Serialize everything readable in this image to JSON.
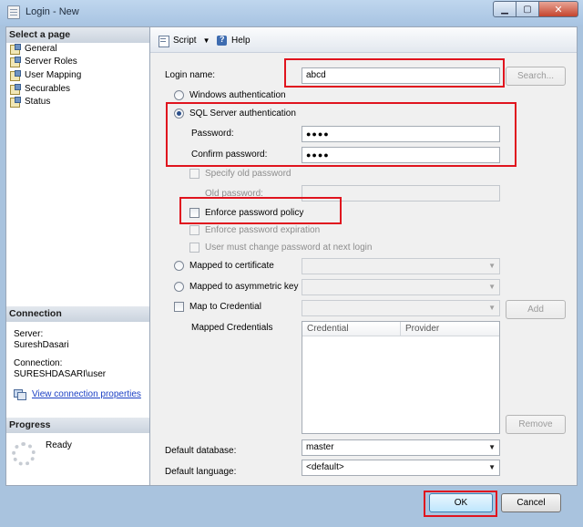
{
  "window": {
    "title": "Login - New"
  },
  "left": {
    "select_page_header": "Select a page",
    "pages": [
      {
        "label": "General"
      },
      {
        "label": "Server Roles"
      },
      {
        "label": "User Mapping"
      },
      {
        "label": "Securables"
      },
      {
        "label": "Status"
      }
    ],
    "connection_header": "Connection",
    "server_label": "Server:",
    "server_value": "SureshDasari",
    "connection_label": "Connection:",
    "connection_value": "SURESHDASARI\\user",
    "view_props_link": "View connection properties",
    "progress_header": "Progress",
    "progress_status": "Ready"
  },
  "toolbar": {
    "script_label": "Script",
    "help_label": "Help"
  },
  "form": {
    "login_name_label": "Login name:",
    "login_name_value": "abcd",
    "search_button": "Search...",
    "windows_auth": "Windows authentication",
    "sql_auth": "SQL Server authentication",
    "password_label": "Password:",
    "password_value": "●●●●",
    "confirm_label": "Confirm password:",
    "confirm_value": "●●●●",
    "specify_old": "Specify old password",
    "old_password_label": "Old password:",
    "enforce_policy": "Enforce password policy",
    "enforce_expiration": "Enforce password expiration",
    "must_change": "User must change password at next login",
    "mapped_cert": "Mapped to certificate",
    "mapped_asym": "Mapped to asymmetric key",
    "map_credential": "Map to Credential",
    "add_button": "Add",
    "mapped_credentials_label": "Mapped Credentials",
    "col_credential": "Credential",
    "col_provider": "Provider",
    "remove_button": "Remove",
    "default_db_label": "Default database:",
    "default_db_value": "master",
    "default_lang_label": "Default language:",
    "default_lang_value": "<default>"
  },
  "footer": {
    "ok": "OK",
    "cancel": "Cancel"
  },
  "colors": {
    "highlight": "#e0141e",
    "link": "#1a3fc4",
    "chrome": "#a9c3de"
  },
  "icons": {
    "page": "page-icon",
    "script": "script-icon",
    "help": "help-icon",
    "minimize": "minimize-icon",
    "maximize": "maximize-icon",
    "close": "close-icon"
  }
}
